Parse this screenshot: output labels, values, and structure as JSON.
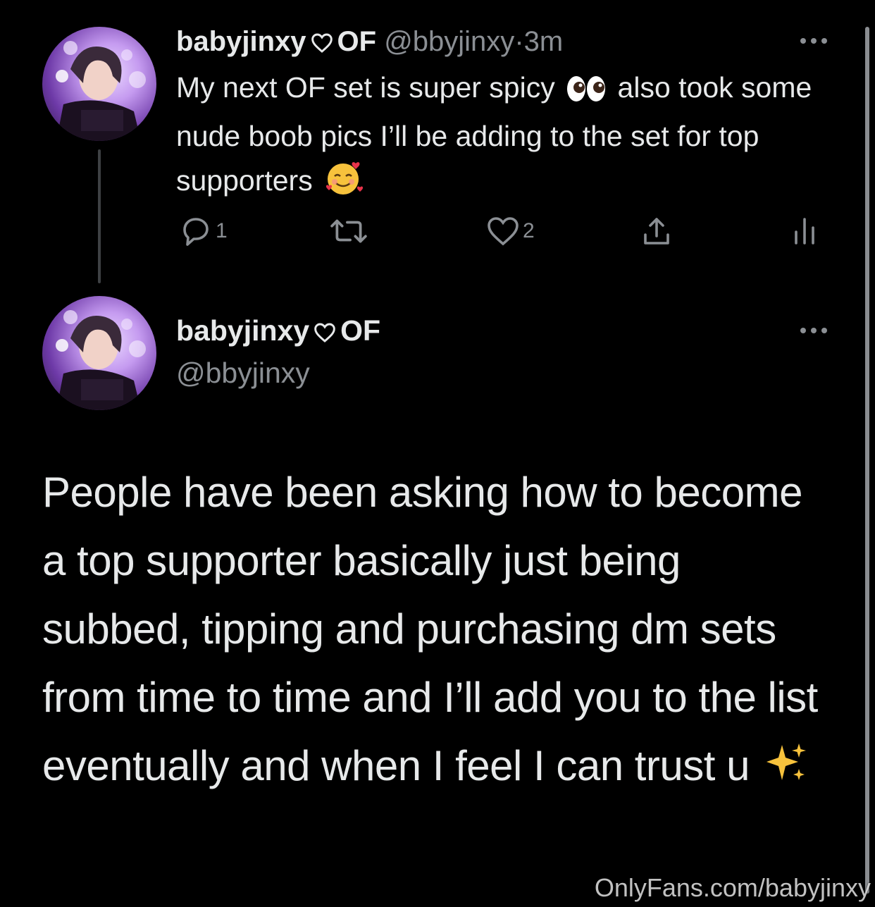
{
  "colors": {
    "background": "#000000",
    "text_primary": "#e7e9ea",
    "text_secondary": "#8b8f94",
    "thread_line": "#3e4144"
  },
  "tweet1": {
    "display_name": "babyjinxy",
    "name_suffix": "OF",
    "handle": "@bbyjinxy",
    "separator": "·",
    "time": "3m",
    "text_part1": "My next OF set is super spicy",
    "text_part2": "also took some nude boob pics I’ll be adding to the set for top supporters",
    "emoji1": "eyes-emoji",
    "emoji2": "smiling-face-with-hearts-emoji",
    "actions": {
      "reply_count": "1",
      "retweet_count": "",
      "like_count": "2"
    }
  },
  "tweet2": {
    "display_name": "babyjinxy",
    "name_suffix": "OF",
    "handle": "@bbyjinxy",
    "text": "People have been asking how to become a top supporter basically just being subbed, tipping and purchasing dm sets from time to time and I’ll add you to the list eventually and when I feel I can trust u",
    "emoji": "sparkles-emoji"
  },
  "watermark": "OnlyFans.com/babyjinxy"
}
